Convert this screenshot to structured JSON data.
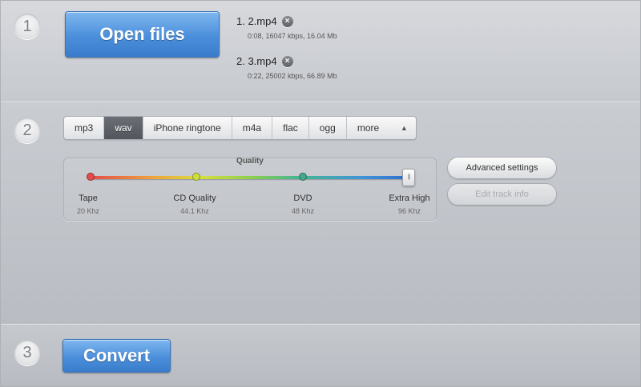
{
  "steps": {
    "one": "1",
    "two": "2",
    "three": "3"
  },
  "open_files_label": "Open files",
  "files": [
    {
      "name": "1. 2.mp4",
      "meta": "0:08, 16047 kbps, 16.04 Mb",
      "remove_icon": "close-circle-icon"
    },
    {
      "name": "2. 3.mp4",
      "meta": "0:22, 25002 kbps, 66.89 Mb",
      "remove_icon": "close-circle-icon"
    }
  ],
  "format_tabs": [
    "mp3",
    "wav",
    "iPhone ringtone",
    "m4a",
    "flac",
    "ogg",
    "more"
  ],
  "active_format": "wav",
  "quality": {
    "title": "Quality",
    "levels": [
      {
        "label": "Tape",
        "freq": "20 Khz",
        "color": "#e34b4b"
      },
      {
        "label": "CD Quality",
        "freq": "44.1 Khz",
        "color": "#cddf3e"
      },
      {
        "label": "DVD",
        "freq": "48 Khz",
        "color": "#45a88a"
      },
      {
        "label": "Extra High",
        "freq": "96 Khz",
        "color": "#2f6fd1"
      }
    ],
    "selected": "Extra High"
  },
  "advanced_settings_label": "Advanced settings",
  "edit_track_info_label": "Edit track info",
  "convert_label": "Convert",
  "colors": {
    "accent": "#4b8fdb",
    "active_tab": "#5d6167"
  }
}
